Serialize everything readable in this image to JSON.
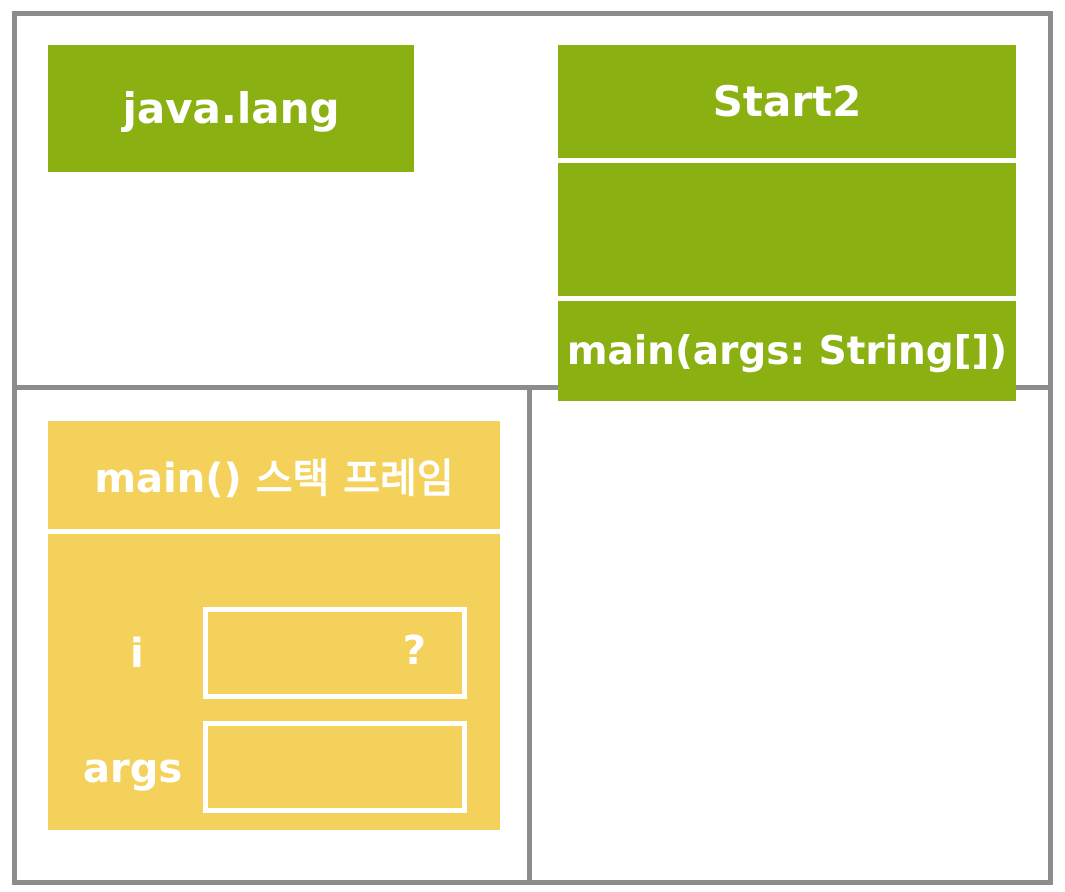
{
  "method_area": {
    "package": "java.lang",
    "class": {
      "name": "Start2",
      "fields": "",
      "methods": "main(args: String[])"
    }
  },
  "stack_area": {
    "frame": {
      "title": "main() 스택 프레임",
      "variables": [
        {
          "name": "i",
          "value": "?"
        },
        {
          "name": "args",
          "value": ""
        }
      ]
    }
  },
  "heap_area": {},
  "colors": {
    "border": "#8c8c8c",
    "class_green": "#8bb012",
    "frame_yellow": "#f4d15a",
    "text": "#ffffff"
  }
}
